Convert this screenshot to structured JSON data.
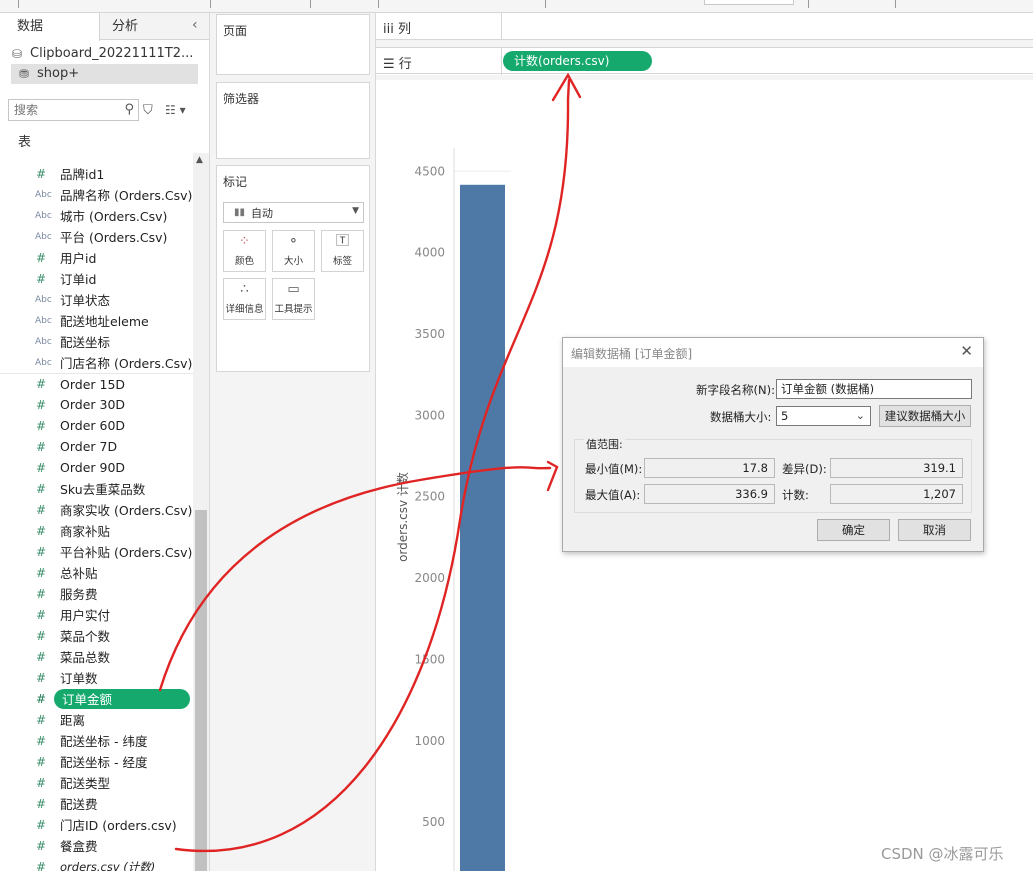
{
  "left_pane": {
    "tabs": [
      "数据",
      "分析"
    ],
    "datasources": [
      "Clipboard_20221111T2...",
      "shop+"
    ],
    "search_placeholder": "搜索",
    "section_title": "表",
    "fields": [
      {
        "icon": "#",
        "label": "品牌id1"
      },
      {
        "icon": "Abc",
        "label": "品牌名称 (Orders.Csv)"
      },
      {
        "icon": "Abc",
        "label": "城市 (Orders.Csv)"
      },
      {
        "icon": "Abc",
        "label": "平台 (Orders.Csv)"
      },
      {
        "icon": "#",
        "label": "用户id"
      },
      {
        "icon": "#",
        "label": "订单id"
      },
      {
        "icon": "Abc",
        "label": "订单状态"
      },
      {
        "icon": "Abc",
        "label": "配送地址eleme"
      },
      {
        "icon": "Abc",
        "label": "配送坐标"
      },
      {
        "icon": "Abc",
        "label": "门店名称 (Orders.Csv)"
      },
      {
        "icon": "#",
        "label": "Order 15D"
      },
      {
        "icon": "#",
        "label": "Order 30D"
      },
      {
        "icon": "#",
        "label": "Order 60D"
      },
      {
        "icon": "#",
        "label": "Order 7D"
      },
      {
        "icon": "#",
        "label": "Order 90D"
      },
      {
        "icon": "#",
        "label": "Sku去重菜品数"
      },
      {
        "icon": "#",
        "label": "商家实收 (Orders.Csv)"
      },
      {
        "icon": "#",
        "label": "商家补贴"
      },
      {
        "icon": "#",
        "label": "平台补贴 (Orders.Csv)"
      },
      {
        "icon": "#",
        "label": "总补贴"
      },
      {
        "icon": "#",
        "label": "服务费"
      },
      {
        "icon": "#",
        "label": "用户实付"
      },
      {
        "icon": "#",
        "label": "菜品个数"
      },
      {
        "icon": "#",
        "label": "菜品总数"
      },
      {
        "icon": "#",
        "label": "订单数"
      },
      {
        "icon": "#",
        "label": "订单金额"
      },
      {
        "icon": "#",
        "label": "距离"
      },
      {
        "icon": "#",
        "label": "配送坐标 - 纬度"
      },
      {
        "icon": "#",
        "label": "配送坐标 - 经度"
      },
      {
        "icon": "#",
        "label": "配送类型"
      },
      {
        "icon": "#",
        "label": "配送费"
      },
      {
        "icon": "#",
        "label": "门店ID (orders.csv)"
      },
      {
        "icon": "#",
        "label": "餐盒费"
      },
      {
        "icon": "#",
        "label": "orders.csv (计数)"
      }
    ],
    "selected_field": "订单金额"
  },
  "mid_pane": {
    "pages_title": "页面",
    "filters_title": "筛选器",
    "marks_title": "标记",
    "mark_type": "自动",
    "mark_buttons": [
      "颜色",
      "大小",
      "标签",
      "详细信息",
      "工具提示"
    ]
  },
  "shelves": {
    "columns_label": "列",
    "rows_label": "行",
    "rows_pill": "计数(orders.csv)"
  },
  "chart_data": {
    "type": "bar",
    "categories": [
      ""
    ],
    "values": [
      4417
    ],
    "ylabel": "orders.csv 计数",
    "yticks": [
      500,
      1000,
      1500,
      2000,
      2500,
      3000,
      3500,
      4000,
      4500
    ],
    "ylim": [
      200,
      4600
    ],
    "color": "#4e79a7"
  },
  "dialog": {
    "title": "编辑数据桶 [订单金额]",
    "new_field_label": "新字段名称(N):",
    "new_field_value": "订单金额 (数据桶)",
    "bin_size_label": "数据桶大小:",
    "bin_size_value": "5",
    "suggest_button": "建议数据桶大小",
    "range_group": "值范围:",
    "min_label": "最小值(M):",
    "min_value": "17.8",
    "diff_label": "差异(D):",
    "diff_value": "319.1",
    "max_label": "最大值(A):",
    "max_value": "336.9",
    "count_label": "计数:",
    "count_value": "1,207",
    "ok_button": "确定",
    "cancel_button": "取消"
  },
  "watermark": "CSDN @冰露可乐",
  "annotation_color": "#e02424"
}
